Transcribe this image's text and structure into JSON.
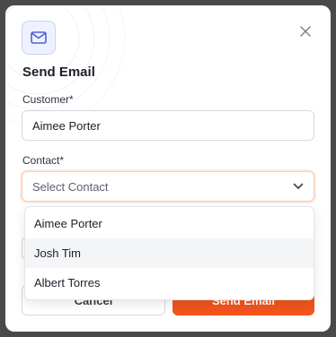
{
  "modal": {
    "title": "Send Email",
    "icon": "mail-icon",
    "accent_color": "#f2541b"
  },
  "customer": {
    "label": "Customer*",
    "value": "Aimee Porter"
  },
  "contact": {
    "label": "Contact*",
    "placeholder": "Select Contact",
    "options": [
      "Aimee Porter",
      "Josh Tim",
      "Albert Torres"
    ],
    "highlighted_index": 1
  },
  "footer": {
    "cancel_label": "Cancel",
    "send_label": "Send Email"
  }
}
